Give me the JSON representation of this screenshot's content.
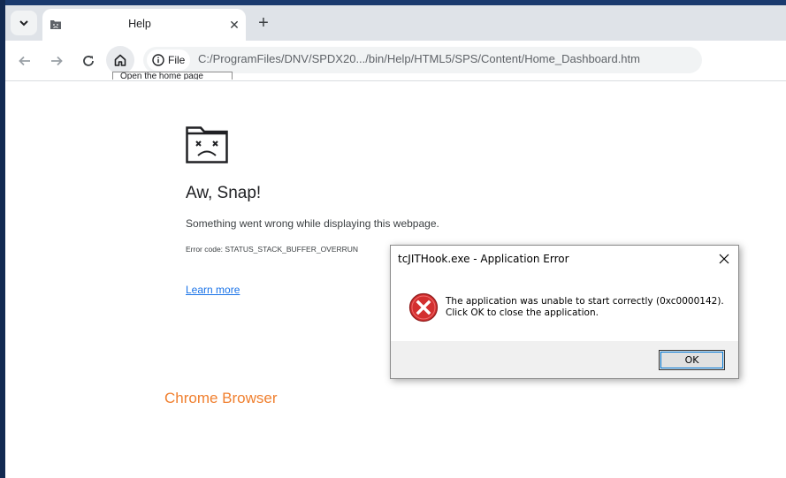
{
  "browser": {
    "tab": {
      "title": "Help",
      "close_glyph": "✕",
      "favicon": "sad-folder-icon"
    },
    "new_tab_glyph": "+",
    "toolbar": {
      "back_icon": "back-arrow-icon",
      "forward_icon": "forward-arrow-icon",
      "reload_icon": "reload-icon",
      "home_icon": "home-icon",
      "scheme_chip": "File",
      "url": "C:/ProgramFiles/DNV/SPDX20.../bin/Help/HTML5/SPS/Content/Home_Dashboard.htm"
    },
    "tooltip_fragment": "Open the home page"
  },
  "crash_page": {
    "title": "Aw, Snap!",
    "message": "Something went wrong while displaying this webpage.",
    "error_code": "Error code: STATUS_STACK_BUFFER_OVERRUN",
    "learn_more": "Learn more"
  },
  "annotation": {
    "text": "Chrome Browser",
    "color": "#f07f2e"
  },
  "dialog": {
    "title": "tcJITHook.exe - Application Error",
    "line1": "The application was unable to start correctly (0xc0000142).",
    "line2": "Click OK to close the application.",
    "ok_label": "OK",
    "icon": "error-x-icon",
    "icon_color": "#d32f2f"
  }
}
